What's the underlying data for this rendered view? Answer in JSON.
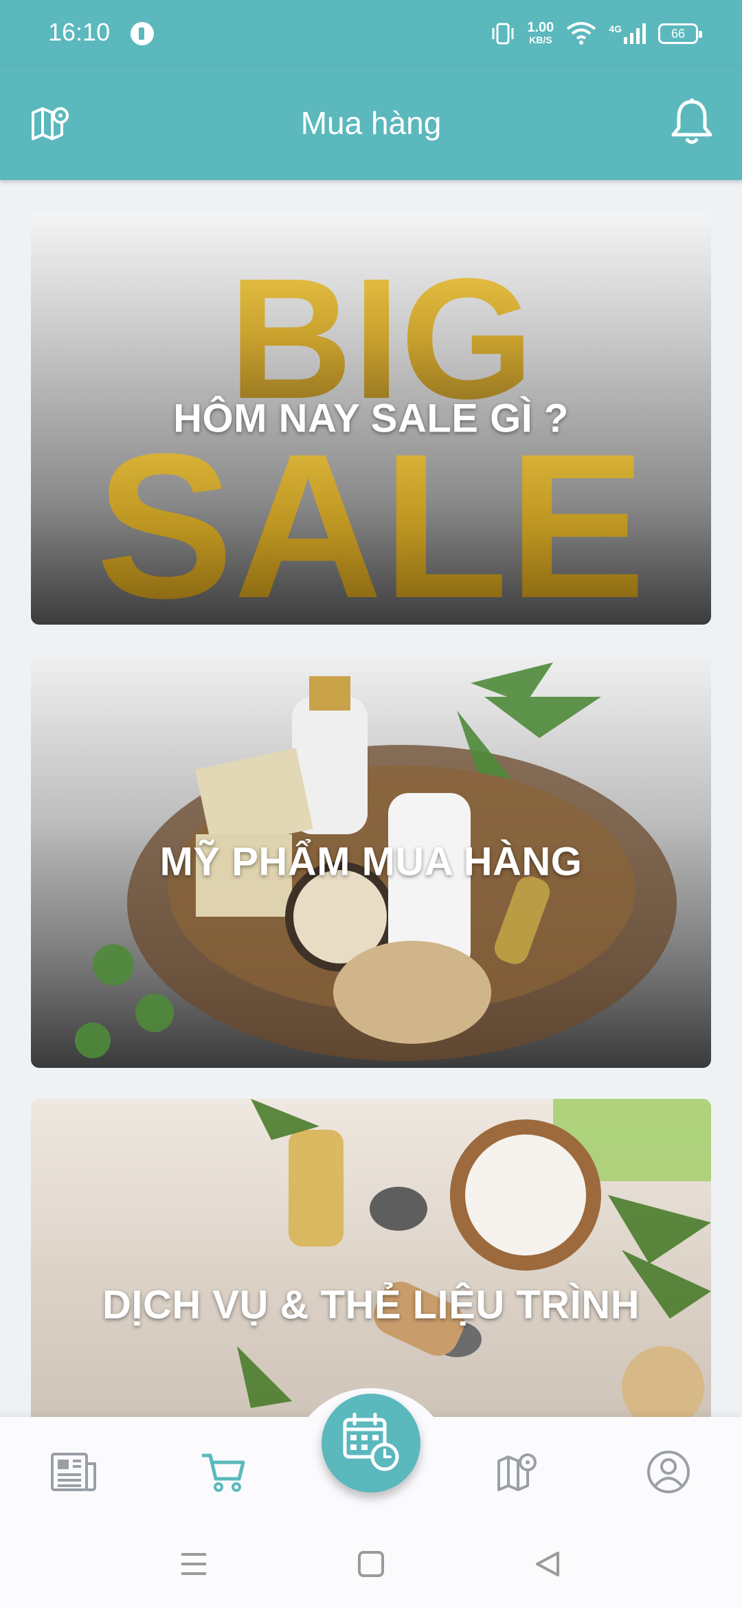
{
  "status_bar": {
    "time": "16:10",
    "speed_value": "1.00",
    "speed_unit": "KB/S",
    "network": "4G",
    "battery": "66"
  },
  "header": {
    "title": "Mua hàng",
    "left_icon": "map-pin-icon",
    "right_icon": "bell-icon"
  },
  "cards": [
    {
      "title": "HÔM NAY SALE GÌ ?"
    },
    {
      "title": "MỸ PHẨM MUA HÀNG"
    },
    {
      "title": "DỊCH VỤ & THẺ LIỆU TRÌNH"
    }
  ],
  "bottom_nav": {
    "items": [
      "news-icon",
      "cart-icon",
      "calendar-clock-icon",
      "map-pin-icon",
      "profile-icon"
    ],
    "active": "cart-icon",
    "accent_color": "#5bb8bd"
  }
}
